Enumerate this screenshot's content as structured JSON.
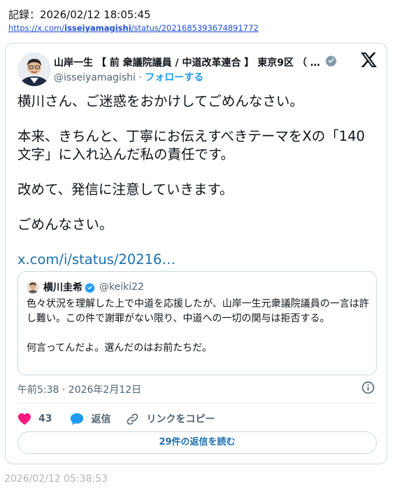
{
  "record": {
    "line": "記録：2026/02/12 18:05:45",
    "url_prefix": "https://x.com/",
    "url_bold": "isseiyamagishi",
    "url_suffix": "/status/2021685393674891772"
  },
  "tweet": {
    "author_name": "山岸一生 【 前 衆議院議員 / 中道改革連合 】 東京9区 （ 練…",
    "handle": "@isseiyamagishi",
    "separator": " · ",
    "follow_label": "フォローする",
    "paragraphs": [
      "横川さん、ご迷惑をおかけしてごめんなさい。",
      "本来、きちんと、丁寧にお伝えすべきテーマをXの「140文字」に入れ込んだ私の責任です。",
      "改めて、発信に注意していきます。",
      "ごめんなさい。"
    ],
    "link": "x.com/i/status/20216…",
    "timestamp": "午前5:38 · 2026年2月12日"
  },
  "quote": {
    "name": "横川圭希",
    "handle": "@keiki22",
    "paragraphs": [
      "色々状況を理解した上で中道を応援したが、山岸一生元衆議院議員の一言は許し難い。この件で謝罪がない限り、中道への一切の関与は拒否する。",
      "何言ってんだよ。選んだのはお前たちだ。"
    ]
  },
  "actions": {
    "like_count": "43",
    "reply_label": "返信",
    "copy_link_label": "リンクをコピー",
    "read_replies_label": "29件の返信を読む"
  },
  "footer": {
    "timestamp": "2026/02/12 05:38:53"
  },
  "colors": {
    "accent": "#1d9bf0",
    "link": "#1d6fb0",
    "like": "#f91880",
    "border": "#cfd9de",
    "muted": "#536471"
  },
  "icons": [
    "verified-badge-icon",
    "x-logo-icon",
    "info-icon",
    "heart-icon",
    "reply-bubble-icon",
    "link-icon"
  ]
}
